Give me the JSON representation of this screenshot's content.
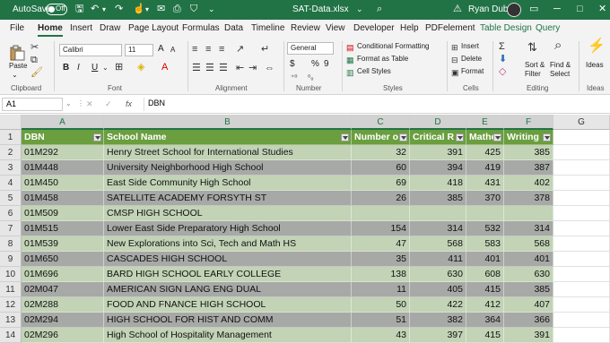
{
  "titlebar": {
    "autosave_label": "AutoSave",
    "autosave_state": "Off",
    "filename": "SAT-Data.xlsx",
    "user_name": "Ryan Dube",
    "accent_color": "#217346"
  },
  "tabs": [
    "File",
    "Home",
    "Insert",
    "Draw",
    "Page Layout",
    "Formulas",
    "Data",
    "Timeline",
    "Review",
    "View",
    "Developer",
    "Help",
    "PDFelement",
    "Table Design",
    "Query"
  ],
  "ribbon": {
    "clipboard": {
      "paste": "Paste",
      "label": "Clipboard"
    },
    "font": {
      "name": "Calibri",
      "size": "11",
      "label": "Font",
      "bold": "B",
      "italic": "I",
      "underline": "U",
      "grow": "A",
      "shrink": "A"
    },
    "alignment": {
      "label": "Alignment"
    },
    "number": {
      "format": "General",
      "currency": "$",
      "percent": "%",
      "comma": "9",
      "label": "Number"
    },
    "styles": {
      "conditional": "Conditional Formatting",
      "table": "Format as Table",
      "cell": "Cell Styles",
      "label": "Styles"
    },
    "cells": {
      "insert": "Insert",
      "delete": "Delete",
      "format": "Format",
      "label": "Cells"
    },
    "editing": {
      "sort": "Sort &",
      "sort2": "Filter",
      "find": "Find &",
      "find2": "Select",
      "label": "Editing"
    },
    "ideas": {
      "button": "Ideas",
      "label": "Ideas"
    }
  },
  "formula_bar": {
    "name_box": "A1",
    "formula": "DBN",
    "cancel": "✕",
    "enter": "✓",
    "fx": "fx"
  },
  "columns": [
    "A",
    "B",
    "C",
    "D",
    "E",
    "F",
    "G"
  ],
  "table": {
    "headers": [
      "DBN",
      "School Name",
      "Number o",
      "Critical R",
      "Mathe",
      "Writing"
    ],
    "rows": [
      [
        "01M292",
        "Henry Street School for International Studies",
        "32",
        "391",
        "425",
        "385"
      ],
      [
        "01M448",
        "University Neighborhood High School",
        "60",
        "394",
        "419",
        "387"
      ],
      [
        "01M450",
        "East Side Community High School",
        "69",
        "418",
        "431",
        "402"
      ],
      [
        "01M458",
        "SATELLITE ACADEMY FORSYTH ST",
        "26",
        "385",
        "370",
        "378"
      ],
      [
        "01M509",
        "CMSP HIGH SCHOOL",
        "",
        "",
        "",
        ""
      ],
      [
        "01M515",
        "Lower East Side Preparatory High School",
        "154",
        "314",
        "532",
        "314"
      ],
      [
        "01M539",
        "New Explorations into Sci, Tech and Math HS",
        "47",
        "568",
        "583",
        "568"
      ],
      [
        "01M650",
        "CASCADES HIGH SCHOOL",
        "35",
        "411",
        "401",
        "401"
      ],
      [
        "01M696",
        "BARD HIGH SCHOOL EARLY COLLEGE",
        "138",
        "630",
        "608",
        "630"
      ],
      [
        "02M047",
        "AMERICAN SIGN LANG ENG DUAL",
        "11",
        "405",
        "415",
        "385"
      ],
      [
        "02M288",
        "FOOD AND FNANCE HIGH SCHOOL",
        "50",
        "422",
        "412",
        "407"
      ],
      [
        "02M294",
        "HIGH SCHOOL FOR HIST AND COMM",
        "51",
        "382",
        "364",
        "366"
      ],
      [
        "02M296",
        "High School of Hospitality Management",
        "43",
        "397",
        "415",
        "391"
      ]
    ],
    "row_numbers": [
      "1",
      "2",
      "3",
      "4",
      "5",
      "6",
      "7",
      "8",
      "9",
      "10",
      "11",
      "12",
      "13",
      "14"
    ]
  }
}
